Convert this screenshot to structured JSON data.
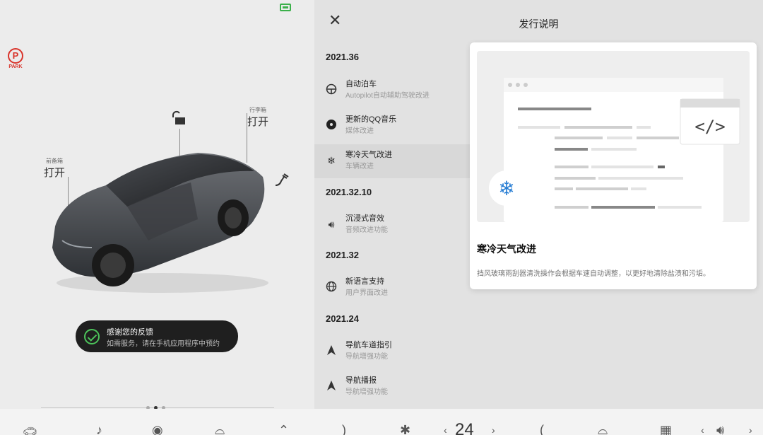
{
  "status": {
    "park_label": "PARK",
    "park_glyph": "P"
  },
  "vehicle": {
    "frunk": {
      "small": "前备箱",
      "action": "打开"
    },
    "trunk": {
      "small": "行李箱",
      "action": "打开"
    }
  },
  "toast": {
    "title": "感谢您的反馈",
    "message": "如需服务，请在手机应用程序中预约"
  },
  "release_notes": {
    "title": "发行说明",
    "sections": [
      {
        "version": "2021.36",
        "items": [
          {
            "icon": "steering-wheel-icon",
            "title": "自动泊车",
            "subtitle": "Autopilot自动辅助驾驶改进"
          },
          {
            "icon": "music-icon",
            "title": "更新的QQ音乐",
            "subtitle": "媒体改进"
          },
          {
            "icon": "snowflake-icon",
            "title": "寒冷天气改进",
            "subtitle": "车辆改进",
            "selected": true
          }
        ]
      },
      {
        "version": "2021.32.10",
        "items": [
          {
            "icon": "speaker-icon",
            "title": "沉浸式音效",
            "subtitle": "音频改进功能"
          }
        ]
      },
      {
        "version": "2021.32",
        "items": [
          {
            "icon": "globe-icon",
            "title": "新语言支持",
            "subtitle": "用户界面改进"
          }
        ]
      },
      {
        "version": "2021.24",
        "items": [
          {
            "icon": "navigation-icon",
            "title": "导航车道指引",
            "subtitle": "导航增强功能"
          },
          {
            "icon": "navigation-icon",
            "title": "导航播报",
            "subtitle": "导航增强功能"
          }
        ]
      }
    ]
  },
  "detail": {
    "title": "寒冷天气改进",
    "description": "挡风玻璃雨刮器清洗操作会根据车速自动调整，以更好地清除盐渍和污垢。",
    "code_glyph": "</>"
  },
  "bottom_bar": {
    "temperature": "24"
  },
  "colors": {
    "accent_green": "#3bb04a",
    "park_red": "#d9342b",
    "snowflake_blue": "#2a7fd4"
  }
}
